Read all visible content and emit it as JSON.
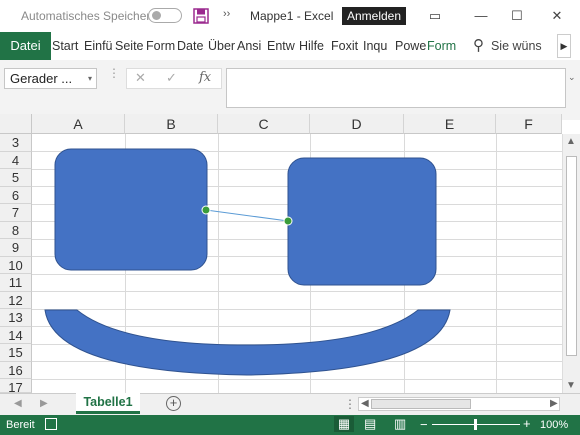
{
  "titlebar": {
    "autosave_label": "Automatisches Speichern",
    "save_icon": "save-icon",
    "more_icon": "chevrons-icon",
    "more_label": "››",
    "doc_title": "Mappe1  -  Excel",
    "signin_label": "Anmelden",
    "ribbon_display_icon": "▭",
    "minimize_icon": "—",
    "maximize_icon": "☐",
    "close_icon": "✕"
  },
  "ribbon": {
    "file_tab": "Datei",
    "tabs": [
      "Start",
      "Einfü",
      "Seite",
      "Form",
      "Date",
      "Über",
      "Ansi",
      "Entw",
      "Hilfe",
      "Foxit",
      "Inqu",
      "Powe",
      "Form"
    ],
    "search_icon": "⚲",
    "search_label": "Sie wüns",
    "scroll_arrow": "▶"
  },
  "formula_bar": {
    "name_box": "Gerader ...",
    "name_box_arrow": "▾",
    "cancel_icon": "✕",
    "enter_icon": "✓",
    "fx_label": "fx",
    "formula_value": "",
    "expand_icon": "⌄"
  },
  "grid": {
    "columns": [
      "A",
      "B",
      "C",
      "D",
      "E",
      "F"
    ],
    "rows": [
      "3",
      "4",
      "5",
      "6",
      "7",
      "8",
      "9",
      "10",
      "11",
      "12",
      "13",
      "14",
      "15",
      "16",
      "17"
    ]
  },
  "shapes": {
    "fill_color": "#4472c4",
    "outline_color": "#2f528f",
    "connector_color": "#5b9bd5",
    "handle_color": "#3a9c3a"
  },
  "sheets": {
    "nav_prev": "◀",
    "nav_next": "▶",
    "active_sheet": "Tabelle1",
    "add_label": "+",
    "options_icon": "⋮"
  },
  "status": {
    "ready_label": "Bereit",
    "view_normal_icon": "▦",
    "view_layout_icon": "▤",
    "view_break_icon": "▥",
    "zoom_minus": "−",
    "zoom_plus": "+",
    "zoom_value": "100%",
    "zoom_level": 100
  }
}
